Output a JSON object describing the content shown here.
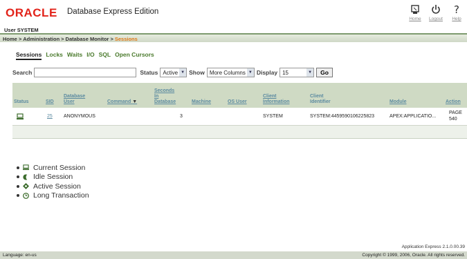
{
  "header": {
    "logo": "ORACLE",
    "product": "Database Express Edition",
    "links": [
      {
        "label": "Home",
        "icon": "home-icon"
      },
      {
        "label": "Logout",
        "icon": "logout-icon"
      },
      {
        "label": "Help",
        "icon": "help-icon"
      }
    ],
    "user": "User SYSTEM"
  },
  "breadcrumb": {
    "items": [
      "Home",
      "Administration",
      "Database Monitor"
    ],
    "current": "Sessions",
    "separator": ">"
  },
  "tabs": [
    "Sessions",
    "Locks",
    "Waits",
    "I/O",
    "SQL",
    "Open Cursors"
  ],
  "filters": {
    "search_label": "Search",
    "search_value": "",
    "status_label": "Status",
    "status_value": "Active",
    "show_label": "Show",
    "show_value": "More Columns",
    "display_label": "Display",
    "display_value": "15",
    "go_label": "Go"
  },
  "table": {
    "headers": {
      "status": "Status",
      "sid": "SID",
      "db_user_1": "Database",
      "db_user_2": "User",
      "command": "Command",
      "secs_1": "Seconds",
      "secs_2": "In",
      "secs_3": "Database",
      "machine": "Machine",
      "os_user": "OS User",
      "client_info_1": "Client",
      "client_info_2": "Information",
      "client_id_1": "Client",
      "client_id_2": "Identifier",
      "module": "Module",
      "action": "Action"
    },
    "rows": [
      {
        "sid": "25",
        "db_user": "ANONYMOUS",
        "command": "",
        "seconds": "3",
        "machine": "",
        "os_user": "",
        "client_info": "SYSTEM",
        "client_id": "SYSTEM:4459590106225823",
        "module": "APEX:APPLICATIO...",
        "action_1": "PAGE",
        "action_2": "540"
      }
    ]
  },
  "legend": {
    "items": [
      "Current Session",
      "Idle Session",
      "Active Session",
      "Long Transaction"
    ]
  },
  "footer": {
    "version": "Application Express 2.1.0.00.39",
    "language": "Language: en-us",
    "copyright": "Copyright © 1999, 2006, Oracle. All rights reserved."
  },
  "colors": {
    "brand": "#e2231a",
    "link": "#4a7a2c",
    "header_bg": "#cfdac4",
    "breadcrumb_current": "#e07b1a"
  }
}
